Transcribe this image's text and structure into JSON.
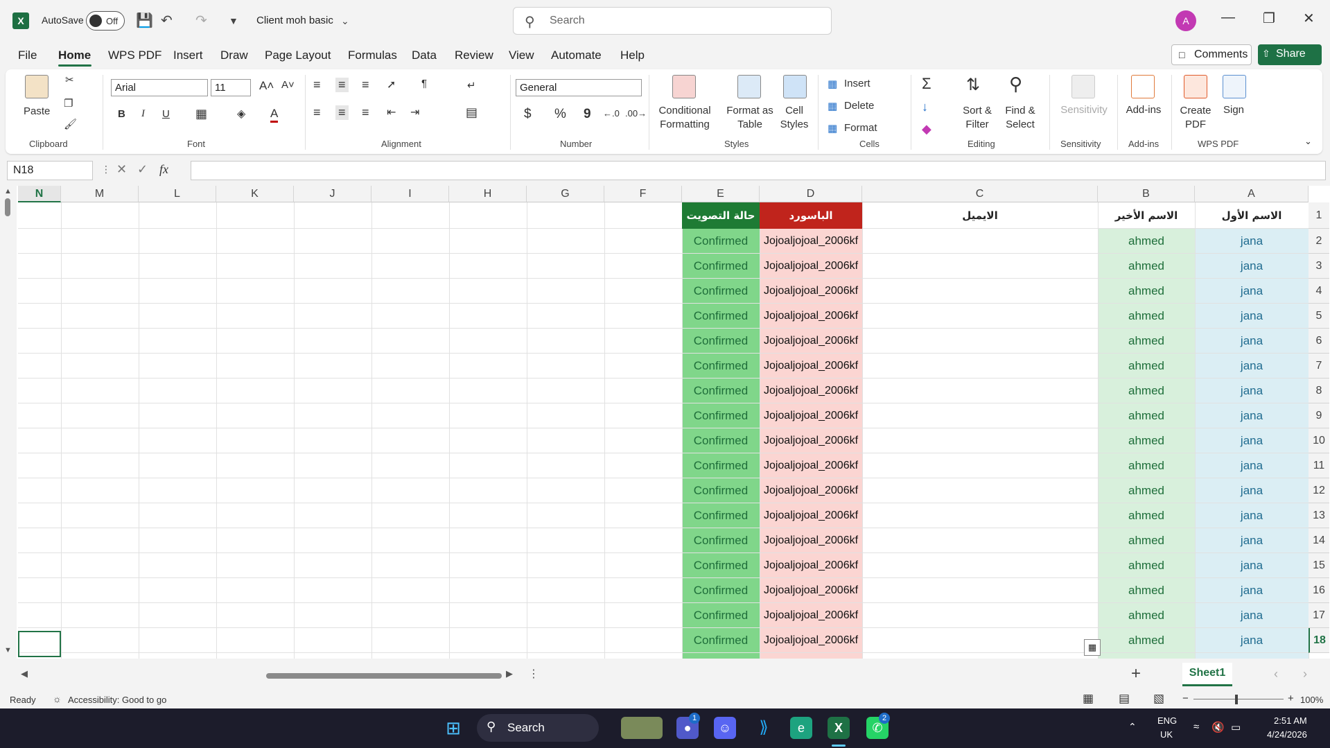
{
  "app": {
    "logo_letter": "X",
    "autosave_label": "AutoSave",
    "autosave_state": "Off",
    "document_title": "Client moh basic",
    "search_placeholder": "Search",
    "avatar_letter": "A",
    "accent_color": "#217346"
  },
  "tabs": [
    "File",
    "Home",
    "WPS PDF",
    "Insert",
    "Draw",
    "Page Layout",
    "Formulas",
    "Data",
    "Review",
    "View",
    "Automate",
    "Help"
  ],
  "active_tab": "Home",
  "header_buttons": {
    "comments": "Comments",
    "share": "Share"
  },
  "ribbon": {
    "clipboard": {
      "label": "Clipboard",
      "paste": "Paste"
    },
    "font": {
      "label": "Font",
      "family": "Arial",
      "size": "11",
      "bold": "B",
      "italic": "I",
      "underline": "U"
    },
    "alignment": {
      "label": "Alignment"
    },
    "number": {
      "label": "Number",
      "format": "General",
      "currency": "$",
      "percent": "%",
      "comma": "9"
    },
    "styles": {
      "label": "Styles",
      "conditional": "Conditional Formatting",
      "format_table": "Format as Table",
      "cell_styles": "Cell Styles"
    },
    "cells": {
      "label": "Cells",
      "insert": "Insert",
      "delete": "Delete",
      "format": "Format"
    },
    "editing": {
      "label": "Editing",
      "sort_filter": "Sort & Filter",
      "find_select": "Find & Select"
    },
    "sensitivity": {
      "label": "Sensitivity",
      "button": "Sensitivity"
    },
    "addins": {
      "label": "Add-ins",
      "button": "Add-ins"
    },
    "wps_pdf": {
      "label": "WPS PDF",
      "create": "Create PDF",
      "sign": "Sign"
    }
  },
  "formula_bar": {
    "name_box": "N18",
    "fx": "fx",
    "content": ""
  },
  "columns": [
    "N",
    "M",
    "L",
    "K",
    "J",
    "I",
    "H",
    "G",
    "F",
    "E",
    "D",
    "C",
    "B",
    "A"
  ],
  "selected_column": "N",
  "rows": [
    "1",
    "2",
    "3",
    "4",
    "5",
    "6",
    "7",
    "8",
    "9",
    "10",
    "11",
    "12",
    "13",
    "14",
    "15",
    "16",
    "17",
    "18"
  ],
  "selected_row": "18",
  "table": {
    "headers": {
      "A": "الاسم الأول",
      "B": "الاسم الأخير",
      "C": "الايميل",
      "D": "الباسورد",
      "E": "حالة التصويت"
    },
    "header_colors": {
      "E": "#1e7b34",
      "D": "#c0241c"
    },
    "column_fill": {
      "A": "#dbeef4",
      "B": "#d8f0dc",
      "D": "#fbd5d2",
      "E": "#80d68a"
    },
    "data": [
      {
        "A": "jana",
        "B": "ahmed",
        "C": "",
        "D": "Jojoaljojoal_2006kf",
        "E": "Confirmed"
      },
      {
        "A": "jana",
        "B": "ahmed",
        "C": "",
        "D": "Jojoaljojoal_2006kf",
        "E": "Confirmed"
      },
      {
        "A": "jana",
        "B": "ahmed",
        "C": "",
        "D": "Jojoaljojoal_2006kf",
        "E": "Confirmed"
      },
      {
        "A": "jana",
        "B": "ahmed",
        "C": "",
        "D": "Jojoaljojoal_2006kf",
        "E": "Confirmed"
      },
      {
        "A": "jana",
        "B": "ahmed",
        "C": "",
        "D": "Jojoaljojoal_2006kf",
        "E": "Confirmed"
      },
      {
        "A": "jana",
        "B": "ahmed",
        "C": "",
        "D": "Jojoaljojoal_2006kf",
        "E": "Confirmed"
      },
      {
        "A": "jana",
        "B": "ahmed",
        "C": "",
        "D": "Jojoaljojoal_2006kf",
        "E": "Confirmed"
      },
      {
        "A": "jana",
        "B": "ahmed",
        "C": "",
        "D": "Jojoaljojoal_2006kf",
        "E": "Confirmed"
      },
      {
        "A": "jana",
        "B": "ahmed",
        "C": "",
        "D": "Jojoaljojoal_2006kf",
        "E": "Confirmed"
      },
      {
        "A": "jana",
        "B": "ahmed",
        "C": "",
        "D": "Jojoaljojoal_2006kf",
        "E": "Confirmed"
      },
      {
        "A": "jana",
        "B": "ahmed",
        "C": "",
        "D": "Jojoaljojoal_2006kf",
        "E": "Confirmed"
      },
      {
        "A": "jana",
        "B": "ahmed",
        "C": "",
        "D": "Jojoaljojoal_2006kf",
        "E": "Confirmed"
      },
      {
        "A": "jana",
        "B": "ahmed",
        "C": "",
        "D": "Jojoaljojoal_2006kf",
        "E": "Confirmed"
      },
      {
        "A": "jana",
        "B": "ahmed",
        "C": "",
        "D": "Jojoaljojoal_2006kf",
        "E": "Confirmed"
      },
      {
        "A": "jana",
        "B": "ahmed",
        "C": "",
        "D": "Jojoaljojoal_2006kf",
        "E": "Confirmed"
      },
      {
        "A": "jana",
        "B": "ahmed",
        "C": "",
        "D": "Jojoaljojoal_2006kf",
        "E": "Confirmed"
      },
      {
        "A": "jana",
        "B": "ahmed",
        "C": "",
        "D": "Jojoaljojoal_2006kf",
        "E": "Confirmed"
      }
    ]
  },
  "sheets": [
    "Sheet1"
  ],
  "status": {
    "ready": "Ready",
    "accessibility": "Accessibility: Good to go",
    "zoom": "100%"
  },
  "taskbar": {
    "search": "Search",
    "language": "ENG",
    "region": "UK",
    "time": "2:51 AM",
    "date": "4/24/2026",
    "teams_badge": "1",
    "whatsapp_badge": "2"
  }
}
